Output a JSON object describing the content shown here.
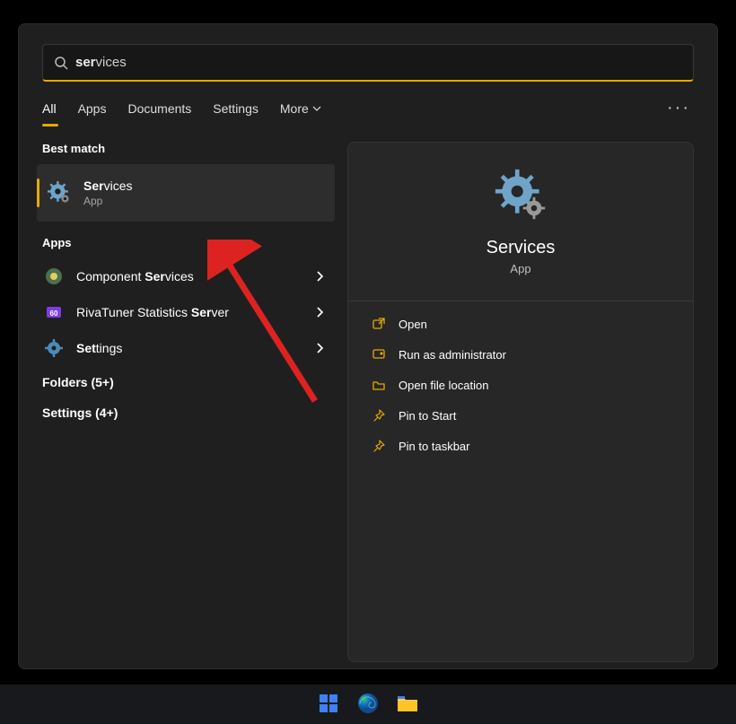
{
  "search": {
    "typed_prefix": "ser",
    "typed_rest": "vices"
  },
  "tabs": {
    "all": "All",
    "apps": "Apps",
    "documents": "Documents",
    "settings": "Settings",
    "more": "More"
  },
  "sections": {
    "best_match": "Best match",
    "apps": "Apps"
  },
  "best_match": {
    "name_bold": "Ser",
    "name_rest": "vices",
    "type": "App"
  },
  "apps": [
    {
      "name_pre": "Component ",
      "name_bold": "Ser",
      "name_post": "vices"
    },
    {
      "name_pre": "RivaTuner Statistics ",
      "name_bold": "Ser",
      "name_post": "ver"
    },
    {
      "name_pre": "",
      "name_bold": "Set",
      "name_post": "tings"
    }
  ],
  "extra": {
    "folders": "Folders (5+)",
    "settings": "Settings (4+)"
  },
  "detail": {
    "title": "Services",
    "type": "App",
    "actions": {
      "open": "Open",
      "admin": "Run as administrator",
      "location": "Open file location",
      "pin_start": "Pin to Start",
      "pin_taskbar": "Pin to taskbar"
    }
  }
}
